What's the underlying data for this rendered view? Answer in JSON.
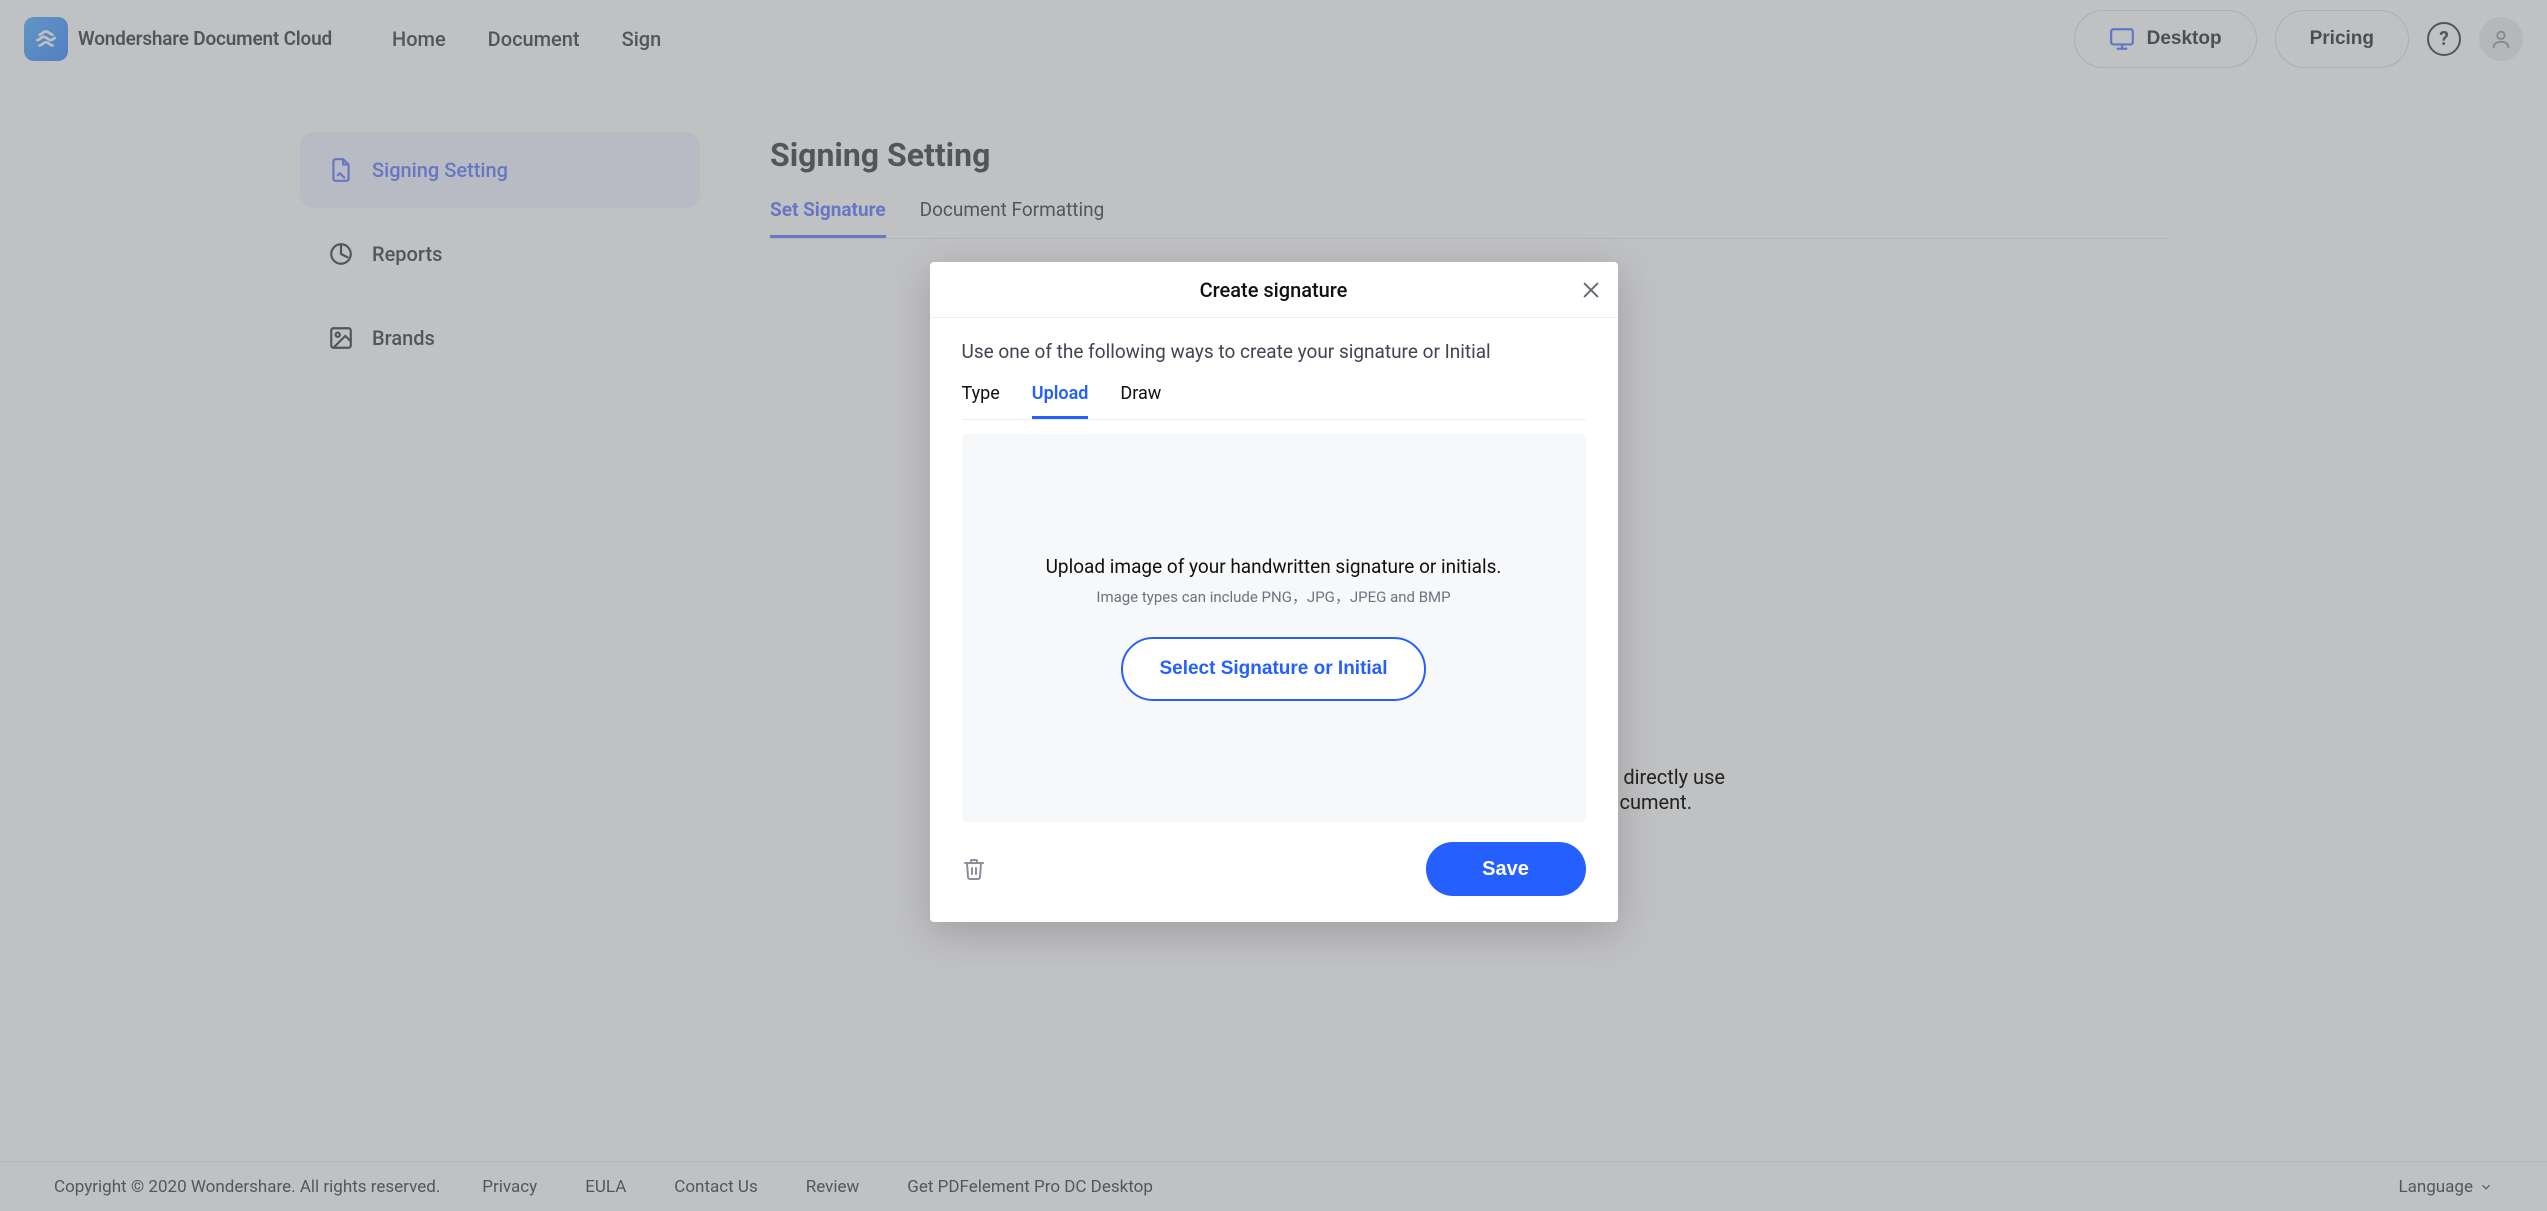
{
  "brand": {
    "name": "Wondershare Document Cloud"
  },
  "nav": {
    "home": "Home",
    "document": "Document",
    "sign": "Sign",
    "desktop": "Desktop",
    "pricing": "Pricing"
  },
  "sidebar": {
    "items": [
      {
        "label": "Signing Setting"
      },
      {
        "label": "Reports"
      },
      {
        "label": "Brands"
      }
    ]
  },
  "page": {
    "title": "Signing Setting",
    "tabs": {
      "set_signature": "Set Signature",
      "doc_formatting": "Document Formatting"
    }
  },
  "background_hint": {
    "line1_suffix": "directly use",
    "line2_suffix": "cument."
  },
  "modal": {
    "title": "Create signature",
    "subtitle": "Use one of the following ways to create your signature or Initial",
    "tabs": {
      "type": "Type",
      "upload": "Upload",
      "draw": "Draw"
    },
    "upload": {
      "line1": "Upload image of your handwritten signature or initials.",
      "line2": "Image types can include PNG，JPG，JPEG and BMP",
      "select_btn": "Select Signature or Initial"
    },
    "save": "Save"
  },
  "footer": {
    "copyright": "Copyright © 2020 Wondershare. All rights reserved.",
    "privacy": "Privacy",
    "eula": "EULA",
    "contact": "Contact Us",
    "review": "Review",
    "get_desktop": "Get PDFelement Pro DC Desktop",
    "language": "Language"
  },
  "colors": {
    "accent": "#2560ff"
  }
}
